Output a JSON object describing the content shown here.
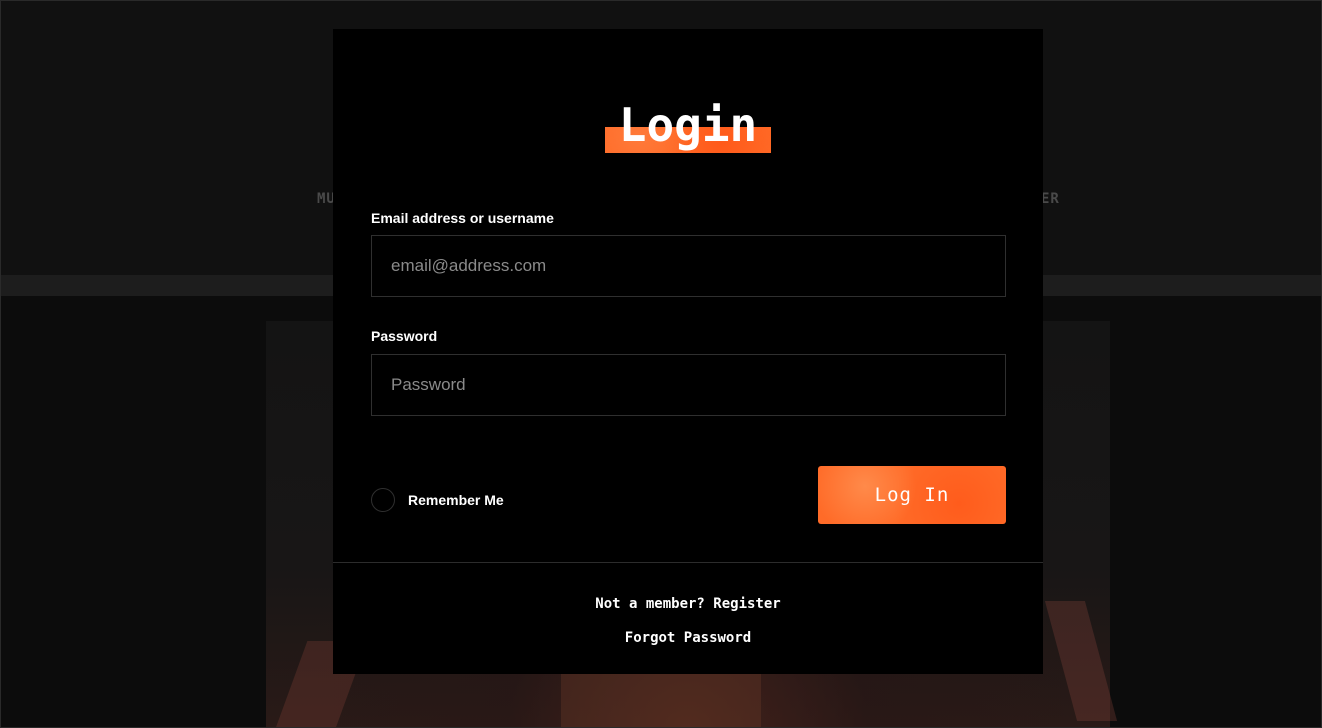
{
  "background": {
    "nav_left_text": "MU",
    "nav_right_text": "ER"
  },
  "modal": {
    "title": "Login",
    "email": {
      "label": "Email address or username",
      "placeholder": "email@address.com",
      "value": ""
    },
    "password": {
      "label": "Password",
      "placeholder": "Password",
      "value": ""
    },
    "remember_me": {
      "label": "Remember Me",
      "checked": false
    },
    "login_button_label": "Log In",
    "register_link": "Not a member? Register",
    "forgot_link": "Forgot Password"
  },
  "colors": {
    "accent": "#ff6b28",
    "modal_bg": "#000000",
    "input_border": "#2f2f2f",
    "text": "#ffffff",
    "placeholder": "#8a8a8a"
  }
}
